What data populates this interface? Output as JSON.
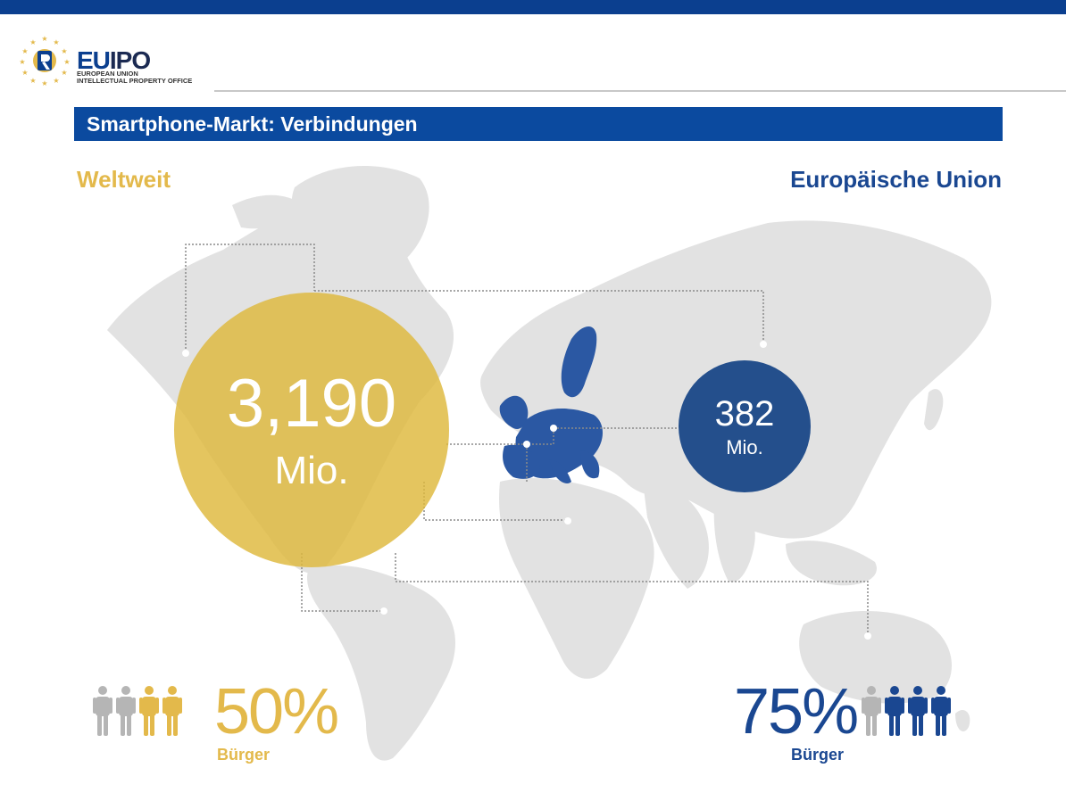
{
  "logo": {
    "name_part1": "EU",
    "name_part2": "IPO",
    "line1": "EUROPEAN UNION",
    "line2": "INTELLECTUAL PROPERTY OFFICE"
  },
  "title": "Smartphone-Markt: Verbindungen",
  "left": {
    "heading": "Weltweit",
    "value": "3,190",
    "unit": "Mio.",
    "percent": "50%",
    "percent_label": "Bürger",
    "people_total": 4,
    "people_highlighted": 2
  },
  "right": {
    "heading": "Europäische Union",
    "value": "382",
    "unit": "Mio.",
    "percent": "75%",
    "percent_label": "Bürger",
    "people_total": 4,
    "people_highlighted": 3
  },
  "colors": {
    "brand_blue": "#0b4a9f",
    "gold": "#e3b94b",
    "eu_blue": "#1a4791",
    "map_gray": "#e2e2e2",
    "person_gray": "#b5b5b5"
  },
  "icons": [
    "person-icon",
    "world-map",
    "eu-map",
    "eu-stars-icon"
  ]
}
